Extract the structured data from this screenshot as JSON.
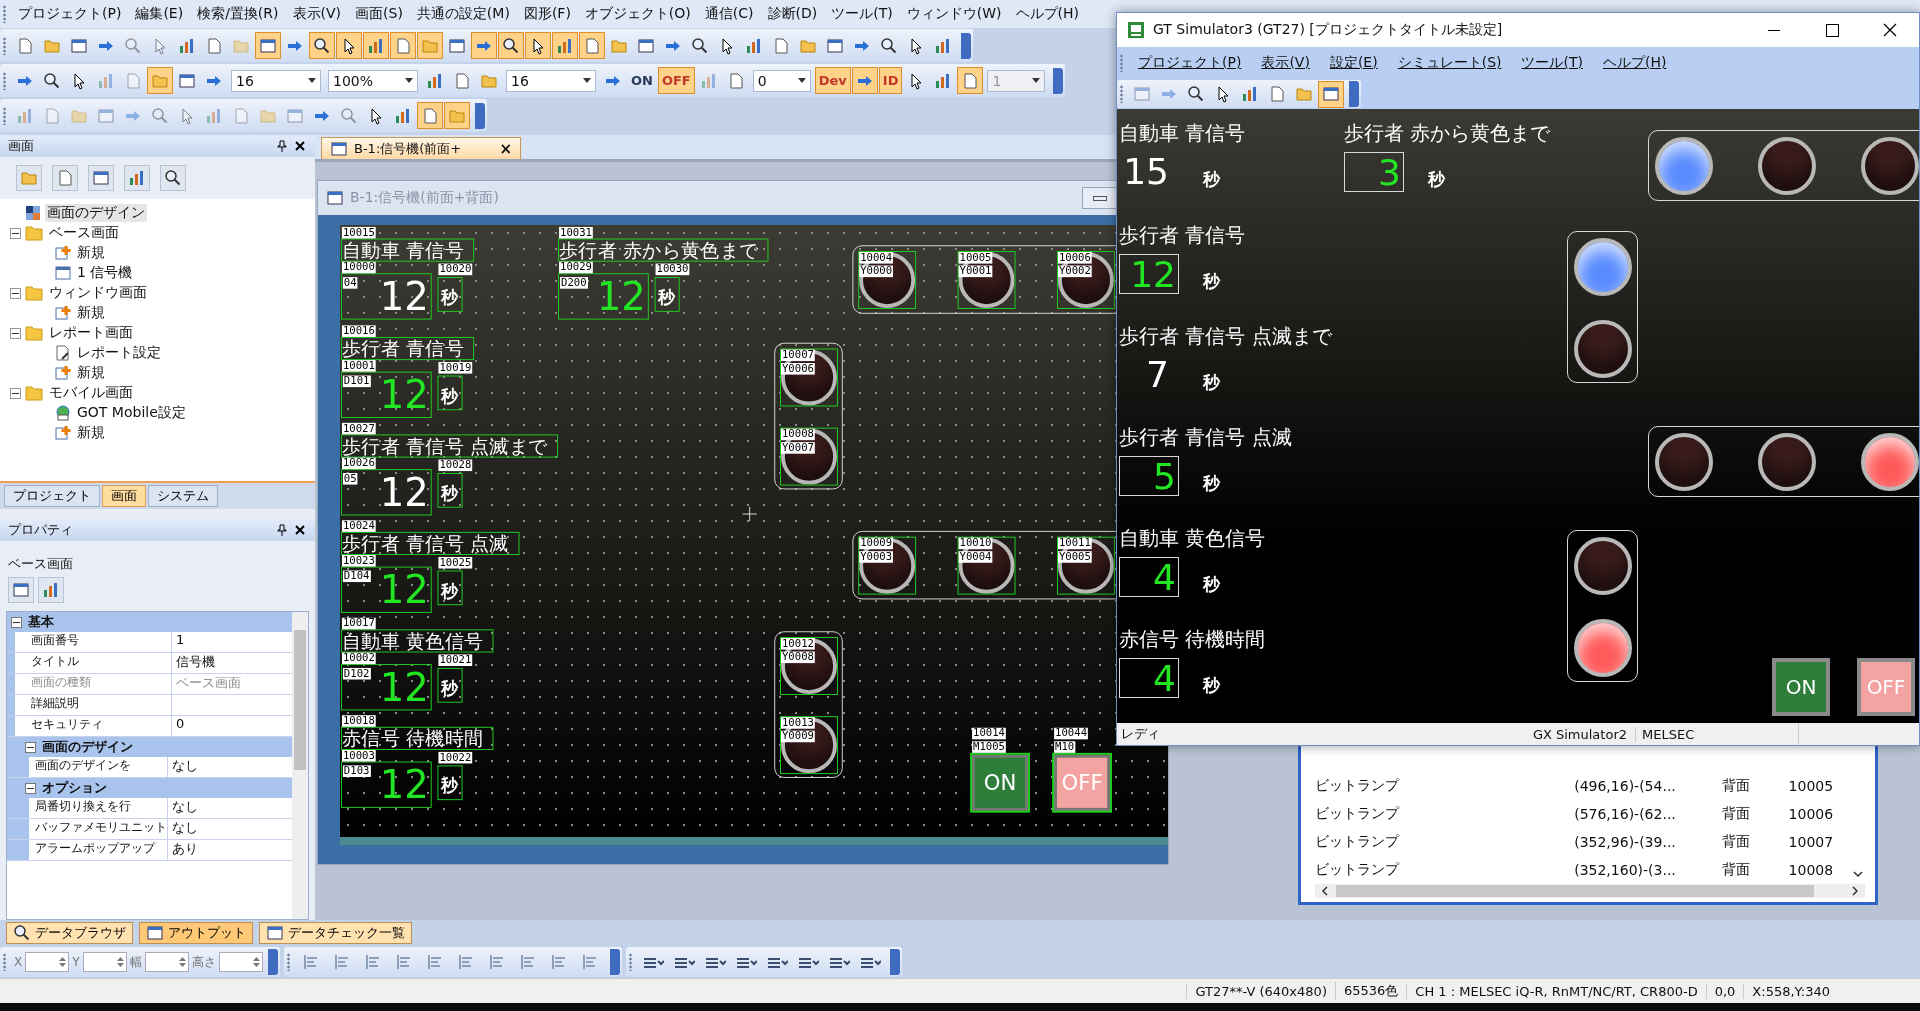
{
  "menu": [
    "プロジェクト(P)",
    "編集(E)",
    "検索/置換(R)",
    "表示(V)",
    "画面(S)",
    "共通の設定(M)",
    "図形(F)",
    "オブジェクト(O)",
    "通信(C)",
    "診断(D)",
    "ツール(T)",
    "ウィンドウ(W)",
    "ヘルプ(H)"
  ],
  "toolbars": [
    {
      "items": [
        {
          "kind": "icon",
          "on": false,
          "disabled": false
        },
        {
          "kind": "icon",
          "on": false,
          "disabled": false
        },
        {
          "kind": "icon",
          "on": false,
          "disabled": false
        },
        {
          "kind": "icon",
          "on": false,
          "disabled": false
        },
        {
          "kind": "icon",
          "on": false,
          "disabled": true
        },
        {
          "kind": "icon",
          "on": false,
          "disabled": true
        },
        {
          "kind": "icon",
          "on": false,
          "disabled": false
        },
        {
          "kind": "icon",
          "on": false,
          "disabled": false
        },
        {
          "kind": "icon",
          "on": false,
          "disabled": true
        },
        {
          "kind": "icon",
          "on": true,
          "disabled": false
        },
        {
          "kind": "icon",
          "on": false,
          "disabled": false
        },
        {
          "kind": "icon",
          "on": true,
          "disabled": false
        },
        {
          "kind": "icon",
          "on": true,
          "disabled": false
        },
        {
          "kind": "icon",
          "on": true,
          "disabled": false
        },
        {
          "kind": "icon",
          "on": true,
          "disabled": false
        },
        {
          "kind": "icon",
          "on": true,
          "disabled": false
        },
        {
          "kind": "icon",
          "on": false,
          "disabled": false
        },
        {
          "kind": "icon",
          "on": true,
          "disabled": false
        },
        {
          "kind": "icon",
          "on": true,
          "disabled": false
        },
        {
          "kind": "icon",
          "on": true,
          "disabled": false
        },
        {
          "kind": "icon",
          "on": true,
          "disabled": false
        },
        {
          "kind": "icon",
          "on": true,
          "disabled": false
        },
        {
          "kind": "icon",
          "on": false,
          "disabled": false
        },
        {
          "kind": "icon",
          "on": false,
          "disabled": false
        },
        {
          "kind": "icon",
          "on": false,
          "disabled": false
        },
        {
          "kind": "icon",
          "on": false,
          "disabled": false
        },
        {
          "kind": "icon",
          "on": false,
          "disabled": false
        },
        {
          "kind": "icon",
          "on": false,
          "disabled": false
        },
        {
          "kind": "icon",
          "on": false,
          "disabled": false
        },
        {
          "kind": "icon",
          "on": false,
          "disabled": false
        },
        {
          "kind": "icon",
          "on": false,
          "disabled": false
        },
        {
          "kind": "icon",
          "on": false,
          "disabled": false
        },
        {
          "kind": "icon",
          "on": false,
          "disabled": false
        },
        {
          "kind": "icon",
          "on": false,
          "disabled": false
        },
        {
          "kind": "icon",
          "on": false,
          "disabled": false
        }
      ]
    },
    {
      "items": [
        {
          "kind": "icon",
          "on": false,
          "disabled": false
        },
        {
          "kind": "icon",
          "on": false,
          "disabled": false
        },
        {
          "kind": "icon",
          "on": false,
          "disabled": false
        },
        {
          "kind": "icon",
          "on": false,
          "disabled": true
        },
        {
          "kind": "icon",
          "on": false,
          "disabled": true
        },
        {
          "kind": "icon",
          "on": true,
          "disabled": false
        },
        {
          "kind": "icon",
          "on": false,
          "disabled": false
        },
        {
          "kind": "icon",
          "on": false,
          "disabled": false
        },
        {
          "kind": "combo",
          "value": "16",
          "disabled": false
        },
        {
          "kind": "combo",
          "value": "100%",
          "disabled": false
        },
        {
          "kind": "icon",
          "on": false,
          "disabled": false
        },
        {
          "kind": "icon",
          "on": false,
          "disabled": false
        },
        {
          "kind": "icon",
          "on": false,
          "disabled": false
        },
        {
          "kind": "combo",
          "value": "16",
          "disabled": false
        },
        {
          "kind": "icon",
          "on": false,
          "disabled": false
        },
        {
          "kind": "text",
          "label": "ON",
          "on": false,
          "disabled": false
        },
        {
          "kind": "text",
          "label": "OFF",
          "on": true,
          "disabled": false
        },
        {
          "kind": "icon",
          "on": false,
          "disabled": true
        },
        {
          "kind": "icon",
          "on": false,
          "disabled": false
        },
        {
          "kind": "combo",
          "value": "0",
          "disabled": false
        },
        {
          "kind": "text",
          "label": "Dev",
          "on": true,
          "disabled": false
        },
        {
          "kind": "icon",
          "on": true,
          "disabled": false
        },
        {
          "kind": "text",
          "label": "ID",
          "on": true,
          "disabled": false
        },
        {
          "kind": "icon",
          "on": false,
          "disabled": false
        },
        {
          "kind": "icon",
          "on": false,
          "disabled": false
        },
        {
          "kind": "icon",
          "on": true,
          "disabled": false
        },
        {
          "kind": "combo",
          "value": "1",
          "disabled": true
        }
      ]
    },
    {
      "items": [
        {
          "kind": "icon",
          "on": false,
          "disabled": true
        },
        {
          "kind": "icon",
          "on": false,
          "disabled": true
        },
        {
          "kind": "icon",
          "on": false,
          "disabled": true
        },
        {
          "kind": "icon",
          "on": false,
          "disabled": true
        },
        {
          "kind": "icon",
          "on": false,
          "disabled": true
        },
        {
          "kind": "icon",
          "on": false,
          "disabled": true
        },
        {
          "kind": "icon",
          "on": false,
          "disabled": true
        },
        {
          "kind": "icon",
          "on": false,
          "disabled": true
        },
        {
          "kind": "icon",
          "on": false,
          "disabled": true
        },
        {
          "kind": "icon",
          "on": false,
          "disabled": true
        },
        {
          "kind": "icon",
          "on": false,
          "disabled": true
        },
        {
          "kind": "icon",
          "on": false,
          "disabled": false
        },
        {
          "kind": "icon",
          "on": false,
          "disabled": true
        },
        {
          "kind": "icon",
          "on": false,
          "disabled": false
        },
        {
          "kind": "icon",
          "on": false,
          "disabled": false
        },
        {
          "kind": "icon",
          "on": true,
          "disabled": false
        },
        {
          "kind": "icon",
          "on": true,
          "disabled": false
        }
      ]
    }
  ],
  "screen_panel": {
    "title": "画面",
    "tree": [
      {
        "label": "画面のデザイン",
        "kind": "design",
        "selected": true
      },
      {
        "label": "ベース画面",
        "kind": "folder",
        "selected": false,
        "expanded": true,
        "children": [
          {
            "label": "新規",
            "kind": "new",
            "selected": false
          },
          {
            "label": "1 信号機",
            "kind": "screen",
            "selected": false
          }
        ]
      },
      {
        "label": "ウィンドウ画面",
        "kind": "folder",
        "selected": false,
        "expanded": true,
        "children": [
          {
            "label": "新規",
            "kind": "new",
            "selected": false
          }
        ]
      },
      {
        "label": "レポート画面",
        "kind": "folder",
        "selected": false,
        "expanded": true,
        "children": [
          {
            "label": "レポート設定",
            "kind": "report",
            "selected": false
          },
          {
            "label": "新規",
            "kind": "new",
            "selected": false
          }
        ]
      },
      {
        "label": "モバイル画面",
        "kind": "folder",
        "selected": false,
        "expanded": true,
        "children": [
          {
            "label": "GOT Mobile設定",
            "kind": "mobile",
            "selected": false
          },
          {
            "label": "新規",
            "kind": "new",
            "selected": false
          }
        ]
      }
    ],
    "tabs": [
      {
        "label": "プロジェクト",
        "selected": false
      },
      {
        "label": "画面",
        "selected": true
      },
      {
        "label": "システム",
        "selected": false
      }
    ]
  },
  "properties": {
    "title": "プロパティ",
    "object": "ベース画面",
    "sections": [
      {
        "title": "基本",
        "kind": "main",
        "expanded": true,
        "rows": [
          {
            "label": "画面番号",
            "value": "1",
            "disabled": false
          },
          {
            "label": "タイトル",
            "value": "信号機",
            "disabled": false
          },
          {
            "label": "画面の種類",
            "value": "ベース画面",
            "disabled": true
          },
          {
            "label": "詳細説明",
            "disabled": false
          },
          {
            "label": "セキュリティ",
            "value": "0",
            "disabled": false
          }
        ]
      },
      {
        "title": "画面のデザイン",
        "kind": "sub",
        "expanded": true,
        "rows": [
          {
            "label": "画面のデザインを",
            "value": "なし",
            "disabled": false
          }
        ]
      },
      {
        "title": "オプション",
        "kind": "sub",
        "expanded": true,
        "rows": [
          {
            "label": "局番切り換えを行",
            "value": "なし",
            "disabled": false
          },
          {
            "label": "バッファメモリユニット",
            "value": "なし",
            "disabled": false
          },
          {
            "label": "アラームポップアップ",
            "value": "あり",
            "disabled": false
          }
        ]
      }
    ]
  },
  "document_tab": {
    "title": "B-1:信号機(前面+",
    "close": "×"
  },
  "editor": {
    "title": "B-1:信号機(前面+背面)",
    "groups": [
      {
        "title_id": "10015",
        "title": "自動車 青信号",
        "value_id": "10000",
        "device": "04",
        "value": "12",
        "kind": "display",
        "unit_id": "10020",
        "unit": "秒"
      },
      {
        "title_id": "10031",
        "title": "歩行者 赤から黄色まで",
        "value_id": "10029",
        "device": "D200",
        "value": "12",
        "kind": "input",
        "unit_id": "10030",
        "unit": "秒"
      },
      {
        "title_id": "10016",
        "title": "歩行者 青信号",
        "value_id": "10001",
        "device": "D101",
        "value": "12",
        "kind": "input",
        "unit_id": "10019",
        "unit": "秒"
      },
      {
        "title_id": "10027",
        "title": "歩行者 青信号 点滅まで",
        "value_id": "10026",
        "device": "05",
        "value": "12",
        "kind": "display",
        "unit_id": "10028",
        "unit": "秒"
      },
      {
        "title_id": "10024",
        "title": "歩行者 青信号 点滅",
        "value_id": "10023",
        "device": "D104",
        "value": "12",
        "kind": "input",
        "unit_id": "10025",
        "unit": "秒"
      },
      {
        "title_id": "10017",
        "title": "自動車 黄色信号",
        "value_id": "10002",
        "device": "D102",
        "value": "12",
        "kind": "input",
        "unit_id": "10021",
        "unit": "秒"
      },
      {
        "title_id": "10018",
        "title": "赤信号 待機時間",
        "value_id": "10003",
        "device": "D103",
        "value": "12",
        "kind": "input",
        "unit_id": "10022",
        "unit": "秒"
      }
    ],
    "frames": [
      {
        "lamps": [
          {
            "id": "10004",
            "device": "Y0000"
          },
          {
            "id": "10005",
            "device": "Y0001"
          },
          {
            "id": "10006",
            "device": "Y0002"
          }
        ]
      },
      {
        "lamps": [
          {
            "id": "10007",
            "device": "Y0006"
          },
          {
            "id": "10008",
            "device": "Y0007"
          }
        ]
      },
      {
        "lamps": [
          {
            "id": "10009",
            "device": "Y0003"
          },
          {
            "id": "10010",
            "device": "Y0004"
          },
          {
            "id": "10011",
            "device": "Y0005"
          }
        ]
      },
      {
        "lamps": [
          {
            "id": "10012",
            "device": "Y0008"
          },
          {
            "id": "10013",
            "device": "Y0009"
          }
        ]
      }
    ],
    "buttons": [
      {
        "id": "10014",
        "device": "M1005",
        "label": "ON",
        "color": "#2e7d3a"
      },
      {
        "id": "10044",
        "device": "M10",
        "label": "OFF",
        "color": "#f4a3a3"
      }
    ]
  },
  "bottom_tabs": [
    {
      "label": "データブラウザ",
      "selected": false
    },
    {
      "label": "アウトプット",
      "selected": true
    },
    {
      "label": "データチェック一覧",
      "selected": false
    }
  ],
  "bottom_fields": [
    {
      "label": "X"
    },
    {
      "label": "Y"
    },
    {
      "label": "幅"
    },
    {
      "label": "高さ"
    }
  ],
  "status_bar": [
    "GT27**-V (640x480)",
    "65536色",
    "CH 1 : MELSEC iQ-R, RnMT/NC/RT, CR800-D",
    "0,0",
    "X:558,Y:340"
  ],
  "object_list": {
    "rows": [
      {
        "type": "ビットランプ",
        "range": "(496,16)-(54...",
        "layer": "背面",
        "id": "10005"
      },
      {
        "type": "ビットランプ",
        "range": "(576,16)-(62...",
        "layer": "背面",
        "id": "10006"
      },
      {
        "type": "ビットランプ",
        "range": "(352,96)-(39...",
        "layer": "背面",
        "id": "10007"
      },
      {
        "type": "ビットランプ",
        "range": "(352,160)-(3...",
        "layer": "背面",
        "id": "10008"
      }
    ]
  },
  "simulator": {
    "title": "GT Simulator3 (GT27)  [プロジェクトタイトル未設定]",
    "menu": [
      "プロジェクト(P)",
      "表示(V)",
      "設定(E)",
      "シミュレート(S)",
      "ツール(T)",
      "ヘルプ(H)"
    ],
    "toolbar": [
      {
        "on": false
      },
      {
        "on": false
      },
      {
        "on": false
      },
      {
        "on": false
      },
      {
        "on": false
      },
      {
        "on": false
      },
      {
        "on": false
      },
      {
        "on": true
      }
    ],
    "groups": [
      {
        "title": "自動車 青信号",
        "value": "15",
        "kind": "display",
        "unit": "秒"
      },
      {
        "title": "歩行者 赤から黄色まで",
        "value": "3",
        "kind": "input",
        "unit": "秒"
      },
      {
        "title": "歩行者 青信号",
        "value": "12",
        "kind": "input",
        "unit": "秒"
      },
      {
        "title": "歩行者 青信号 点滅まで",
        "value": "7",
        "kind": "display",
        "unit": "秒"
      },
      {
        "title": "歩行者 青信号 点滅",
        "value": "5",
        "kind": "input",
        "unit": "秒"
      },
      {
        "title": "自動車 黄色信号",
        "value": "4",
        "kind": "input",
        "unit": "秒"
      },
      {
        "title": "赤信号 待機時間",
        "value": "4",
        "kind": "input",
        "unit": "秒"
      }
    ],
    "frames": [
      {
        "lamps": [
          {
            "on": true,
            "color": "#5a8cff"
          },
          {
            "on": false
          },
          {
            "on": false
          }
        ]
      },
      {
        "lamps": [
          {
            "on": true,
            "color": "#5a8cff"
          },
          {
            "on": false
          }
        ]
      },
      {
        "lamps": [
          {
            "on": false
          },
          {
            "on": false
          },
          {
            "on": true,
            "color": "#ff5a5a"
          }
        ]
      },
      {
        "lamps": [
          {
            "on": false
          },
          {
            "on": true,
            "color": "#ff5a5a"
          }
        ]
      }
    ],
    "buttons": [
      {
        "label": "ON",
        "color": "#2e7d3a"
      },
      {
        "label": "OFF",
        "color": "#f4a3a3"
      }
    ],
    "status": [
      "レディ",
      "GX Simulator2",
      "MELSEC"
    ]
  }
}
